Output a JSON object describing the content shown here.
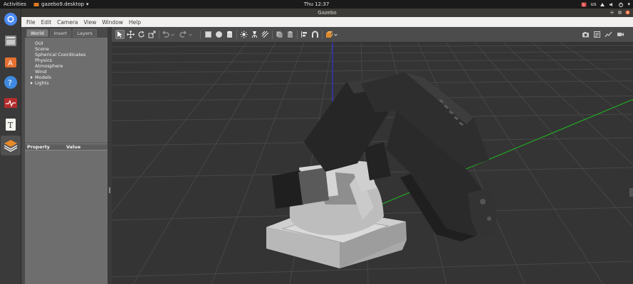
{
  "topbar": {
    "activities": "Activities",
    "app_menu": "gazebo9.desktop",
    "clock": "Thu 12:37",
    "keyboard_layout": "us"
  },
  "window": {
    "title": "Gazebo"
  },
  "menubar": [
    "File",
    "Edit",
    "Camera",
    "View",
    "Window",
    "Help"
  ],
  "left_panel": {
    "tabs": [
      "World",
      "Insert",
      "Layers"
    ],
    "active_tab": "World",
    "tree": [
      "GUI",
      "Scene",
      "Spherical Coordinates",
      "Physics",
      "Atmosphere",
      "Wind",
      "Models",
      "Lights"
    ],
    "expandable": [
      "Models",
      "Lights"
    ],
    "property_header": {
      "property": "Property",
      "value": "Value"
    }
  },
  "dock": [
    "chromium-icon",
    "files-icon",
    "software-center-icon",
    "help-icon",
    "system-monitor-icon",
    "text-editor-icon",
    "gazebo-icon"
  ],
  "colors": {
    "viewport_bg": "#343434",
    "grid": "#4a4a4a",
    "axis_x": "#d33",
    "axis_y": "#2d2",
    "axis_z": "#33e",
    "robot": "#2a2a2a",
    "base": "#b4b4b4"
  }
}
